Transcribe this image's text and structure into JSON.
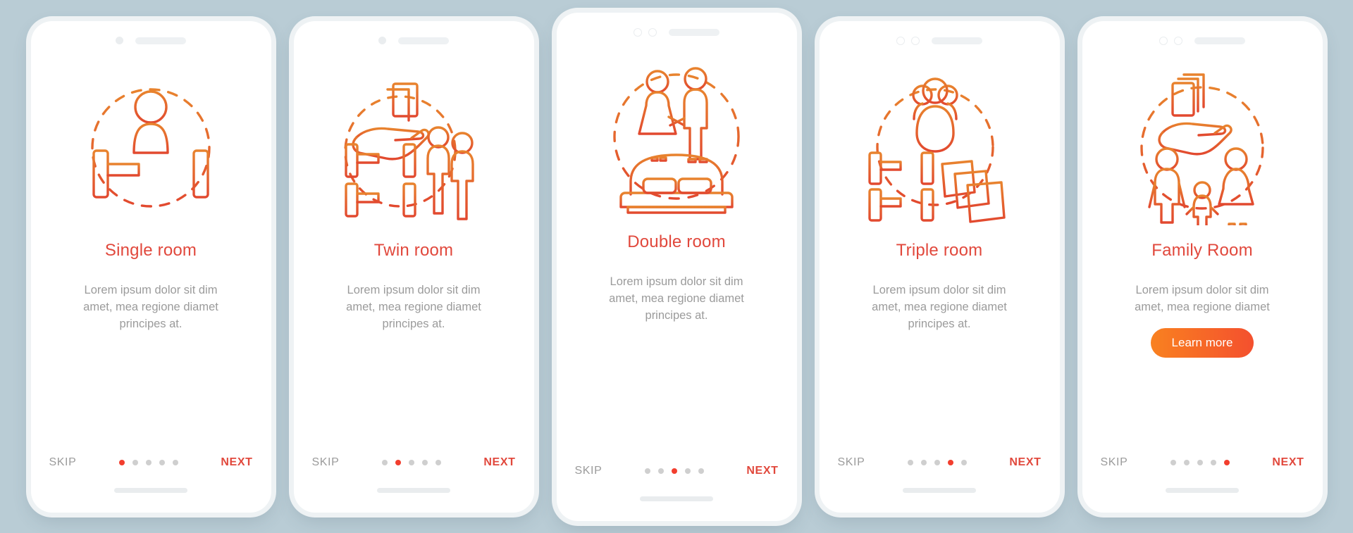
{
  "theme": {
    "background": "#b9ccd5",
    "card_background": "#ffffff",
    "title_color": "#e1483c",
    "body_color": "#9b9b9b",
    "accent_start": "#f98120",
    "accent_end": "#f4502e",
    "dot_active": "#f23e2e",
    "dot_inactive": "#cfcfcf"
  },
  "nav_labels": {
    "skip": "SKIP",
    "next": "NEXT"
  },
  "dot_count": 5,
  "screens": [
    {
      "id": "single-room",
      "title": "Single room",
      "description": "Lorem ipsum dolor sit dim amet, mea regione diamet principes at.",
      "icon": "single-bed-person-icon",
      "active_dot": 1,
      "skip": "SKIP",
      "next": "NEXT",
      "cta": null,
      "notch": "one-dot"
    },
    {
      "id": "twin-room",
      "title": "Twin room",
      "description": "Lorem ipsum dolor sit dim amet, mea regione diamet principes at.",
      "icon": "bunk-beds-two-people-icon",
      "active_dot": 2,
      "skip": "SKIP",
      "next": "NEXT",
      "cta": null,
      "notch": "one-dot"
    },
    {
      "id": "double-room",
      "title": "Double room",
      "description": "Lorem ipsum dolor sit dim amet, mea regione diamet principes at.",
      "icon": "double-bed-couple-icon",
      "active_dot": 3,
      "skip": "SKIP",
      "next": "NEXT",
      "cta": null,
      "notch": "two-rings"
    },
    {
      "id": "triple-room",
      "title": "Triple room",
      "description": "Lorem ipsum dolor sit dim amet, mea regione diamet principes at.",
      "icon": "bunk-beds-group-pillows-icon",
      "active_dot": 4,
      "skip": "SKIP",
      "next": "NEXT",
      "cta": null,
      "notch": "two-rings"
    },
    {
      "id": "family-room",
      "title": "Family Room",
      "description": "Lorem ipsum dolor sit dim amet, mea regione diamet",
      "icon": "family-hand-books-icon",
      "active_dot": 5,
      "skip": "SKIP",
      "next": "NEXT",
      "cta": "Learn more",
      "notch": "two-rings"
    }
  ]
}
